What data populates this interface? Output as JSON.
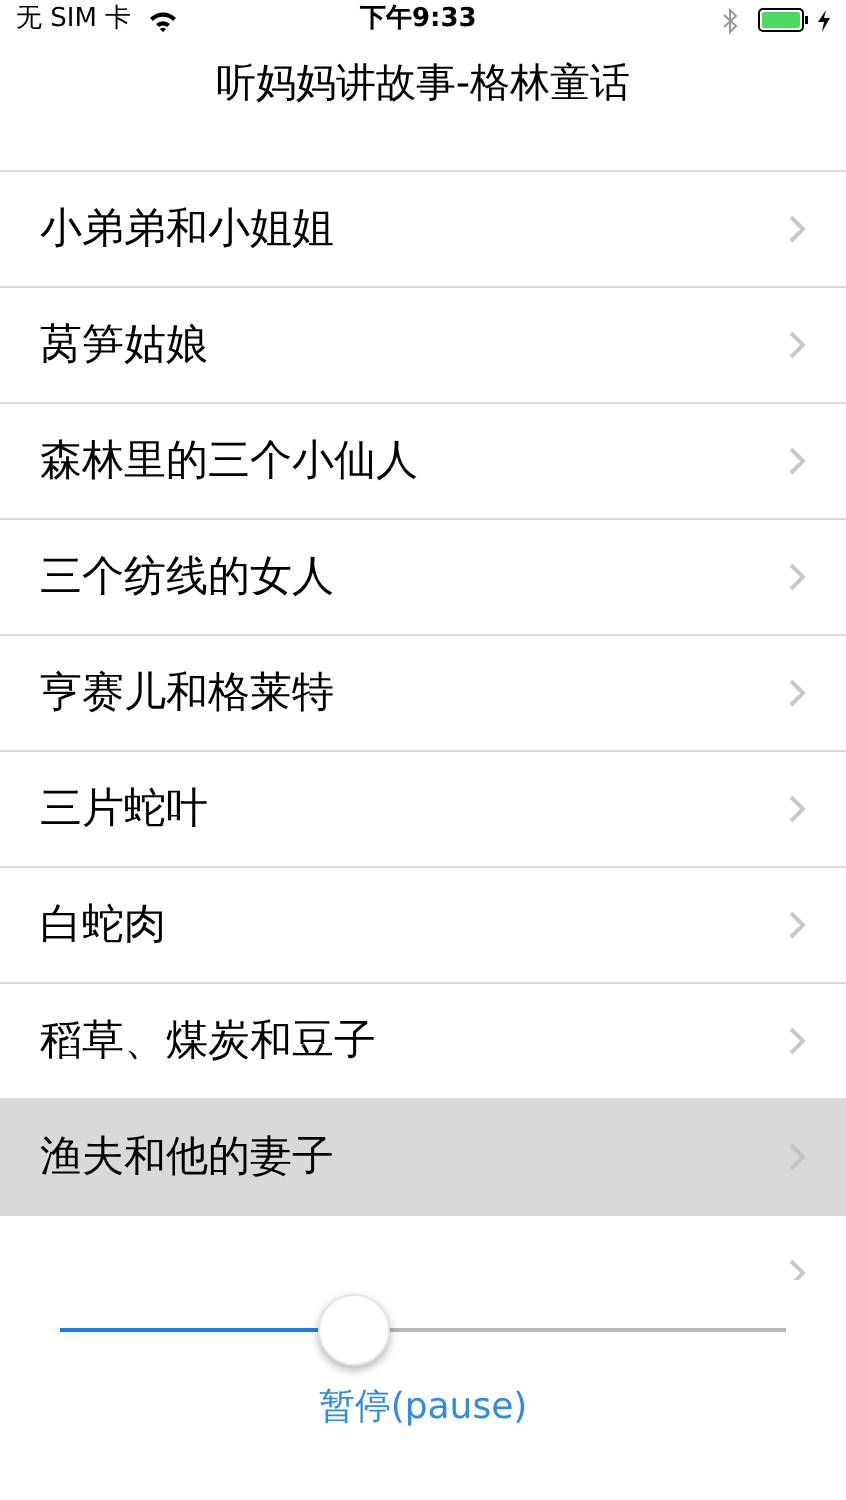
{
  "status_bar": {
    "carrier": "无 SIM 卡",
    "time": "下午9:33",
    "charging": true
  },
  "title": "听妈妈讲故事-格林童话",
  "stories": [
    {
      "title": "小弟弟和小姐姐",
      "selected": false
    },
    {
      "title": "莴笋姑娘",
      "selected": false
    },
    {
      "title": "森林里的三个小仙人",
      "selected": false
    },
    {
      "title": "三个纺线的女人",
      "selected": false
    },
    {
      "title": "亨赛儿和格莱特",
      "selected": false
    },
    {
      "title": "三片蛇叶",
      "selected": false
    },
    {
      "title": "白蛇肉",
      "selected": false
    },
    {
      "title": "稻草、煤炭和豆子",
      "selected": false
    },
    {
      "title": "渔夫和他的妻子",
      "selected": true
    },
    {
      "selected": false
    }
  ],
  "player": {
    "level": 0.405,
    "button": "暂停(pause)"
  }
}
